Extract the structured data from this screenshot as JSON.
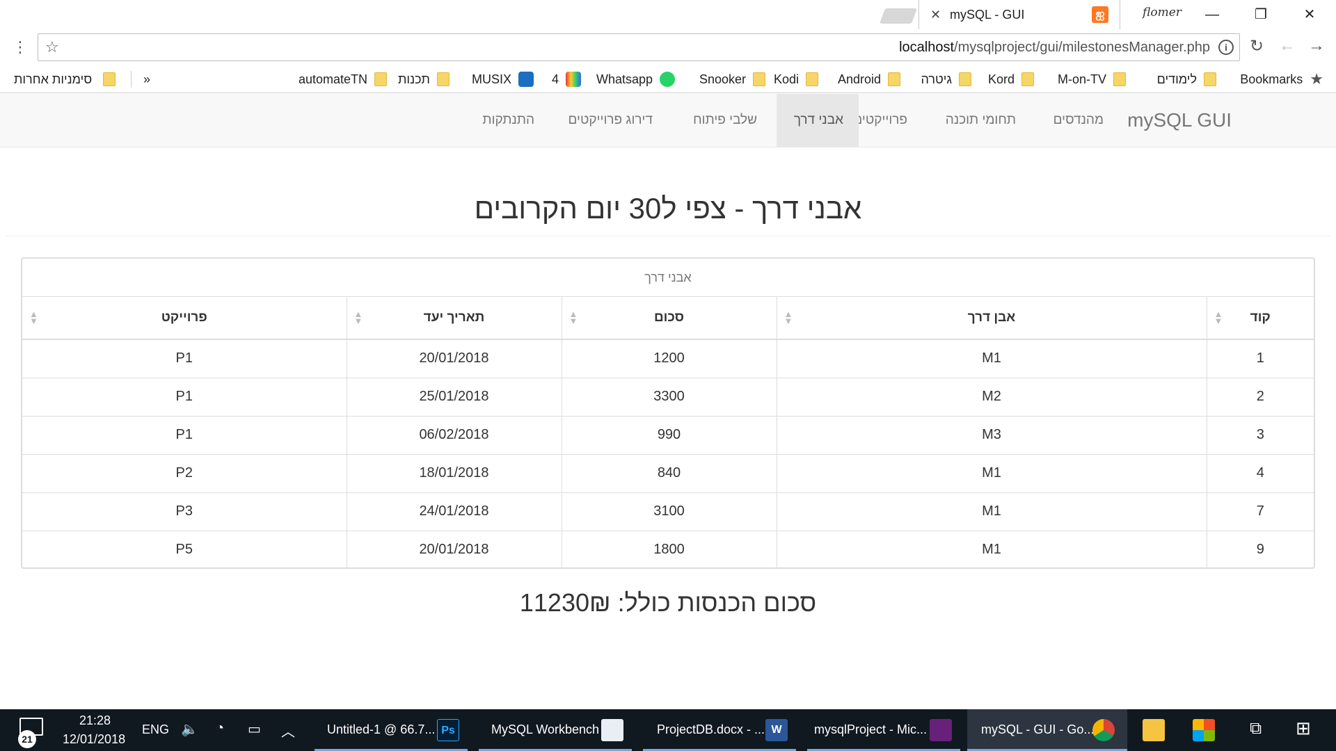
{
  "browser": {
    "tab_title": "mySQL - GUI",
    "profile_name": "flomer",
    "url_host": "localhost",
    "url_path": "/mysqlproject/gui/milestonesManager.php"
  },
  "bookmarks": {
    "items": [
      {
        "label": "Bookmarks",
        "icon": "star-icon"
      },
      {
        "label": "לימודים",
        "icon": "folder-icon"
      },
      {
        "label": "M-on-TV",
        "icon": "folder-icon"
      },
      {
        "label": "Kord",
        "icon": "folder-icon"
      },
      {
        "label": "גיטרה",
        "icon": "folder-icon"
      },
      {
        "label": "Android",
        "icon": "folder-icon"
      },
      {
        "label": "Kodi",
        "icon": "folder-icon"
      },
      {
        "label": "Snooker",
        "icon": "folder-icon"
      },
      {
        "label": "Whatsapp",
        "icon": "whatsapp-icon"
      },
      {
        "label": "4",
        "icon": "tv-icon"
      },
      {
        "label": "MUSIX",
        "icon": "musix-icon"
      },
      {
        "label": "תכנות",
        "icon": "folder-icon"
      },
      {
        "label": "automateTN",
        "icon": "folder-icon"
      }
    ],
    "overflow": "»",
    "other_bookmarks": "סימניות אחרות"
  },
  "navbar": {
    "brand": "mySQL GUI",
    "items": [
      {
        "label": "מהנדסים",
        "active": false
      },
      {
        "label": "תחומי תוכנה",
        "active": false
      },
      {
        "label": "פרוייקטים",
        "active": false
      },
      {
        "label": "אבני דרך",
        "active": true
      },
      {
        "label": "שלבי פיתוח",
        "active": false
      },
      {
        "label": "דירוג פרוייקטים",
        "active": false
      },
      {
        "label": "התנתקות",
        "active": false
      }
    ]
  },
  "page": {
    "title": "אבני דרך - צפי ל30 יום הקרובים",
    "table_caption": "אבני דרך",
    "columns": [
      "קוד",
      "אבן דרך",
      "סכום",
      "תאריך יעד",
      "פרוייקט"
    ],
    "rows": [
      [
        "1",
        "M1",
        "1200",
        "20/01/2018",
        "P1"
      ],
      [
        "2",
        "M2",
        "3300",
        "25/01/2018",
        "P1"
      ],
      [
        "3",
        "M3",
        "990",
        "06/02/2018",
        "P1"
      ],
      [
        "4",
        "M1",
        "840",
        "18/01/2018",
        "P2"
      ],
      [
        "7",
        "M1",
        "3100",
        "24/01/2018",
        "P3"
      ],
      [
        "9",
        "M1",
        "1800",
        "20/01/2018",
        "P5"
      ]
    ],
    "total": "סכום הכנסות כולל: 11230₪"
  },
  "taskbar": {
    "notification_count": "21",
    "time": "21:28",
    "date": "12/01/2018",
    "language": "ENG",
    "apps": [
      {
        "label": "Untitled-1 @ 66.7...",
        "icon": "photoshop-icon",
        "badge": "Ps"
      },
      {
        "label": "MySQL Workbench",
        "icon": "mysql-workbench-icon",
        "badge": ""
      },
      {
        "label": "ProjectDB.docx - ...",
        "icon": "word-icon",
        "badge": "W"
      },
      {
        "label": "mysqlProject - Mic...",
        "icon": "visual-studio-icon",
        "badge": ""
      },
      {
        "label": "mySQL - GUI - Go...",
        "icon": "chrome-icon",
        "badge": ""
      }
    ]
  },
  "colors": {
    "navbar_bg": "#f8f8f8",
    "nav_active_bg": "#e7e7e7",
    "taskbar_bg": "#101820",
    "xampp_orange": "#fb7a24"
  }
}
